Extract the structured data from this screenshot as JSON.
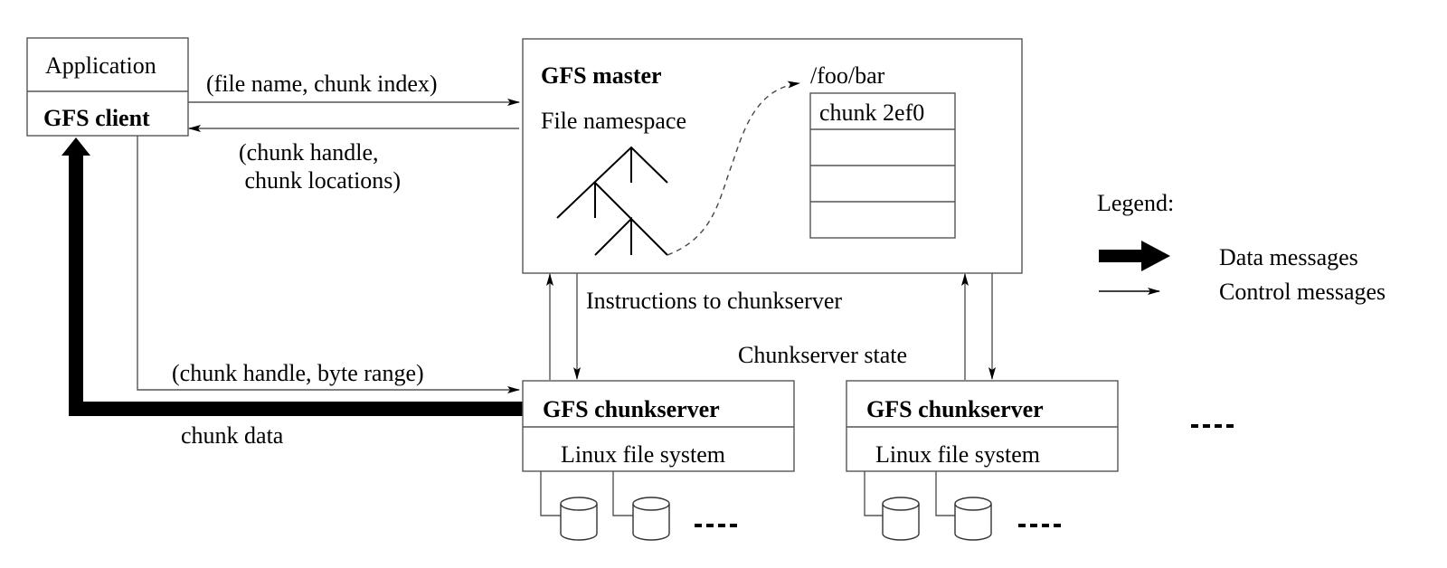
{
  "diagram": {
    "client": {
      "application_label": "Application",
      "client_label": "GFS client"
    },
    "master": {
      "title": "GFS master",
      "namespace_label": "File namespace",
      "file_path": "/foo/bar",
      "chunk_table": [
        "chunk 2ef0",
        "",
        "",
        ""
      ]
    },
    "messages": {
      "request_to_master": "(file name, chunk index)",
      "reply_from_master_line1": "(chunk handle,",
      "reply_from_master_line2": " chunk locations)",
      "request_to_chunkserver": "(chunk handle, byte range)",
      "chunk_data": "chunk data",
      "instructions": "Instructions to chunkserver",
      "chunkserver_state": "Chunkserver state"
    },
    "chunkservers": [
      {
        "title": "GFS chunkserver",
        "fs_label": "Linux file system"
      },
      {
        "title": "GFS chunkserver",
        "fs_label": "Linux file system"
      }
    ],
    "ellipsis": ".....",
    "legend": {
      "title": "Legend:",
      "items": [
        {
          "kind": "data",
          "label": "Data messages"
        },
        {
          "kind": "control",
          "label": "Control messages"
        }
      ]
    }
  }
}
